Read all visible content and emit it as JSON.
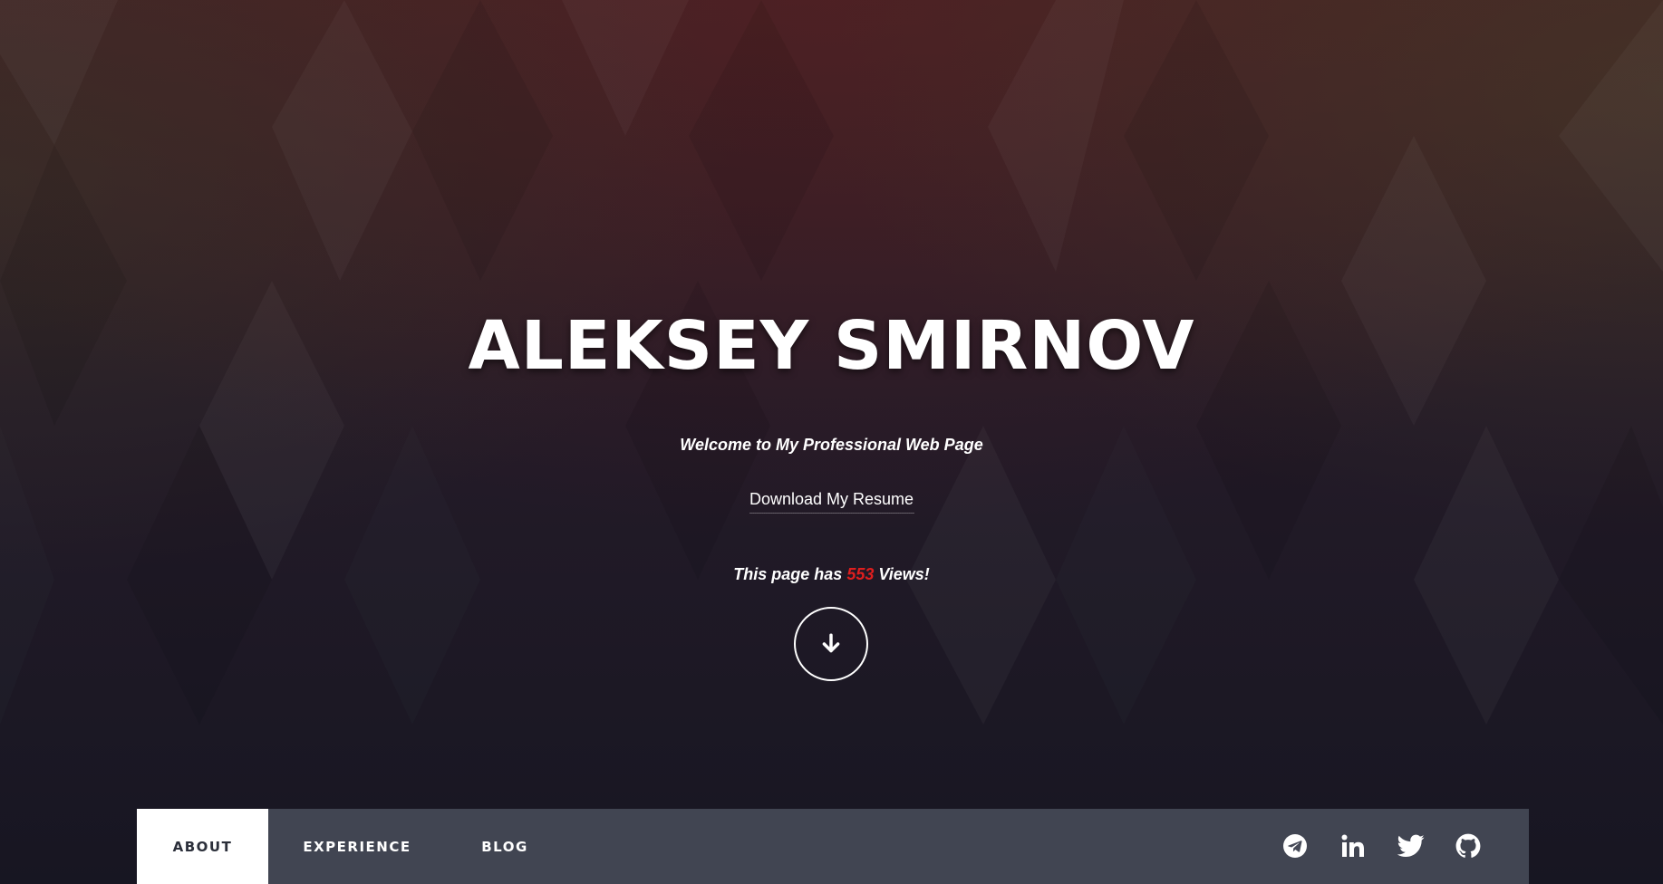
{
  "hero": {
    "name": "ALEKSEY SMIRNOV",
    "tagline": "Welcome to My Professional Web Page",
    "resume_link": "Download My Resume",
    "views_prefix": "This page has",
    "views_count": "553",
    "views_suffix": "Views!"
  },
  "nav": {
    "tabs": [
      {
        "label": "ABOUT",
        "active": true
      },
      {
        "label": "EXPERIENCE",
        "active": false
      },
      {
        "label": "BLOG",
        "active": false
      }
    ],
    "social_icons": [
      "telegram-icon",
      "linkedin-icon",
      "twitter-icon",
      "github-icon"
    ]
  },
  "colors": {
    "views_count": "#e01e1e",
    "active_tab_bg": "#ffffff",
    "active_tab_text": "#2b2f3a",
    "navbar_bg": "#464a58"
  }
}
